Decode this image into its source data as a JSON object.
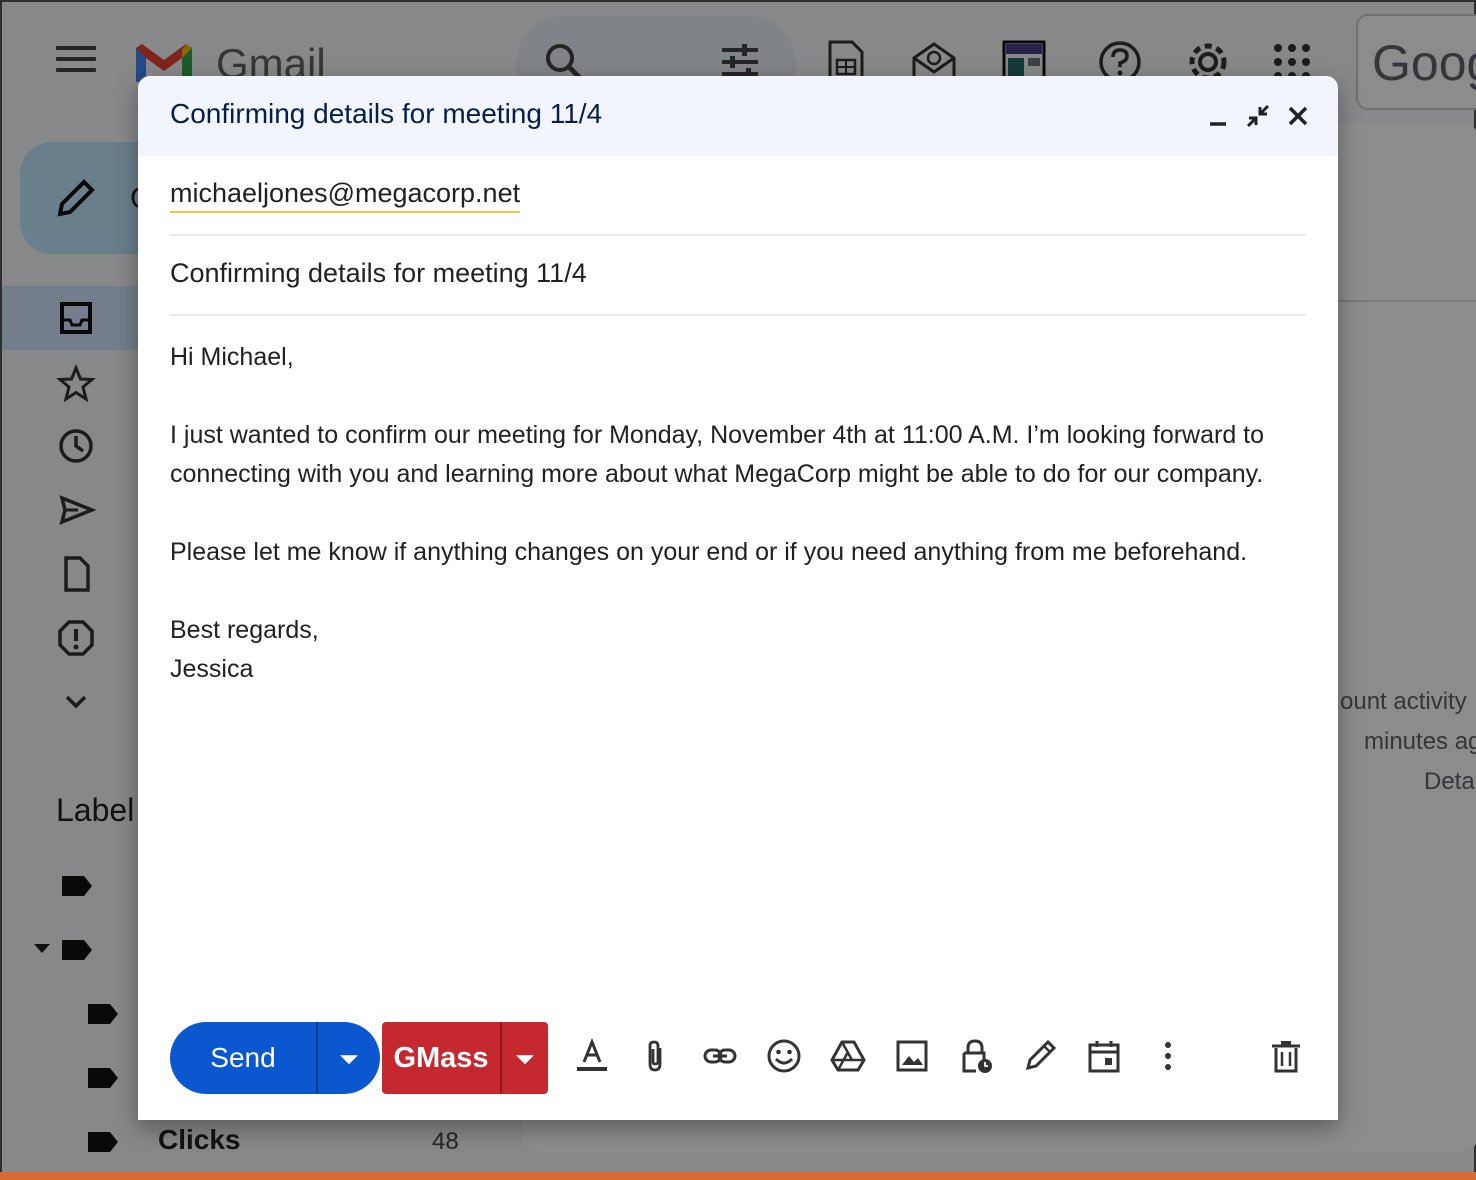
{
  "background": {
    "app_name": "Gmail",
    "google_text": "Goog",
    "compose_partial": "C",
    "labels_title": "Label",
    "label_item": {
      "name": "Clicks",
      "count": "48"
    },
    "activity": {
      "line1": "ount activity",
      "line2": "minutes ag",
      "line3": "Deta"
    }
  },
  "compose": {
    "title": "Confirming details for meeting 11/4",
    "to": "michaeljones@megacorp.net",
    "subject": "Confirming details for meeting 11/4",
    "body": {
      "greeting": "Hi Michael,",
      "paragraph1": "I just wanted to confirm our meeting for Monday, November 4th at 11:00 A.M. I’m looking forward to connecting with you and learning more about what MegaCorp might be able to do for our company.",
      "paragraph2": "Please let me know if anything changes on your end or if you need anything from me beforehand.",
      "closing": "Best regards,",
      "signature": "Jessica"
    },
    "toolbar": {
      "send_label": "Send",
      "gmass_label": "GMass"
    }
  },
  "colors": {
    "send_blue": "#0b57d0",
    "gmass_red": "#c5282f",
    "header_bg": "#f2f6fc",
    "title_color": "#041e49"
  }
}
